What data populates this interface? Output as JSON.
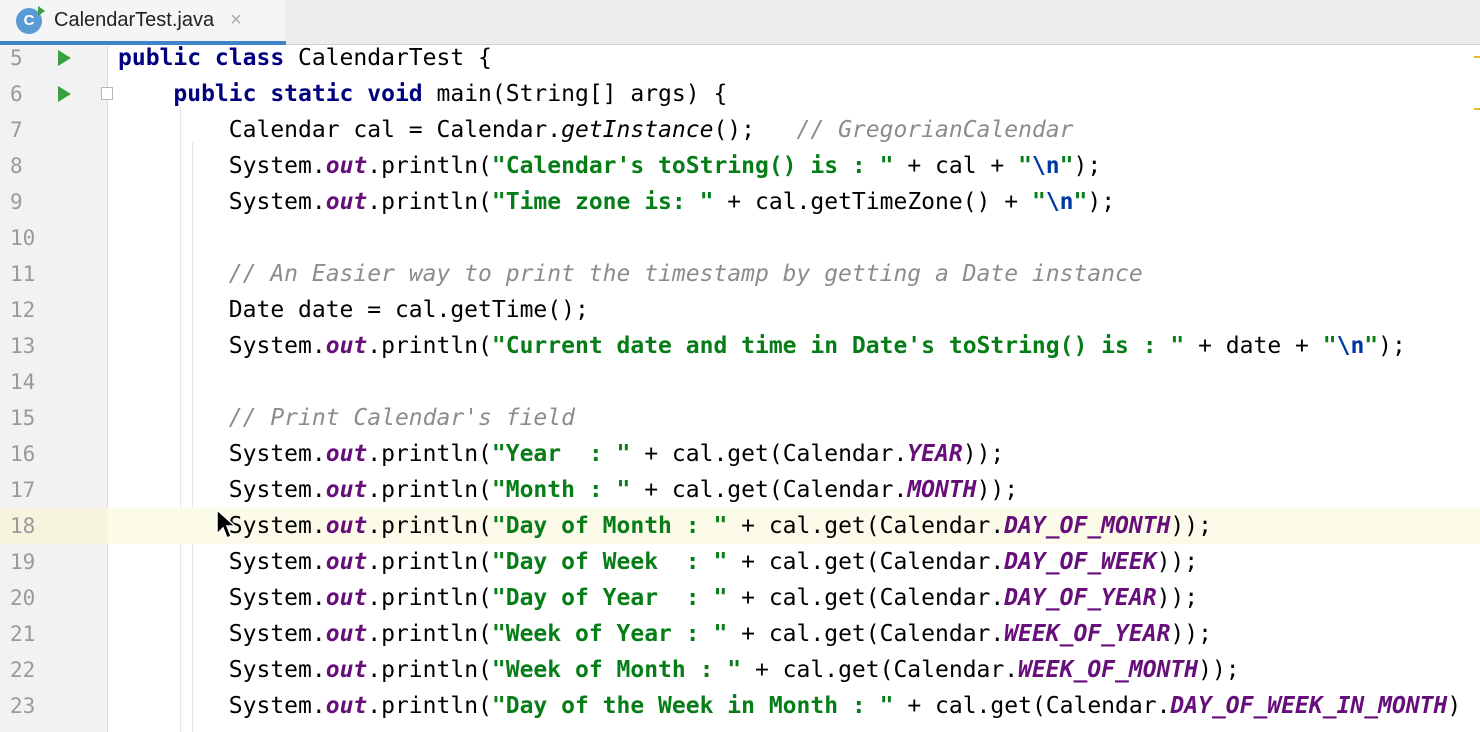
{
  "tab": {
    "filename": "CalendarTest.java",
    "icon": "java-class-icon",
    "close": "×"
  },
  "lines": [
    {
      "n": "5",
      "parts": [
        [
          "kw",
          "public class "
        ],
        [
          "",
          "CalendarTest {"
        ]
      ],
      "run": true
    },
    {
      "n": "6",
      "parts": [
        [
          "",
          "    "
        ],
        [
          "kw",
          "public static void "
        ],
        [
          "",
          "main(String[] args) {"
        ]
      ],
      "run": true,
      "fold": true
    },
    {
      "n": "7",
      "parts": [
        [
          "",
          "        Calendar cal = Calendar."
        ],
        [
          "method-it",
          "getInstance"
        ],
        [
          "",
          "();   "
        ],
        [
          "comment",
          "// GregorianCalendar"
        ]
      ]
    },
    {
      "n": "8",
      "parts": [
        [
          "",
          "        System."
        ],
        [
          "field",
          "out"
        ],
        [
          "",
          ".println("
        ],
        [
          "str",
          "\"Calendar's toString() is : \""
        ],
        [
          "",
          " + cal + "
        ],
        [
          "str",
          "\""
        ],
        [
          "esc",
          "\\n"
        ],
        [
          "str",
          "\""
        ],
        [
          "",
          ");"
        ]
      ]
    },
    {
      "n": "9",
      "parts": [
        [
          "",
          "        System."
        ],
        [
          "field",
          "out"
        ],
        [
          "",
          ".println("
        ],
        [
          "str",
          "\"Time zone is: \""
        ],
        [
          "",
          " + cal.getTimeZone() + "
        ],
        [
          "str",
          "\""
        ],
        [
          "esc",
          "\\n"
        ],
        [
          "str",
          "\""
        ],
        [
          "",
          ");"
        ]
      ]
    },
    {
      "n": "10",
      "parts": []
    },
    {
      "n": "11",
      "parts": [
        [
          "",
          "        "
        ],
        [
          "comment",
          "// An Easier way to print the timestamp by getting a Date instance"
        ]
      ]
    },
    {
      "n": "12",
      "parts": [
        [
          "",
          "        Date date = cal.getTime();"
        ]
      ]
    },
    {
      "n": "13",
      "parts": [
        [
          "",
          "        System."
        ],
        [
          "field",
          "out"
        ],
        [
          "",
          ".println("
        ],
        [
          "str",
          "\"Current date and time in Date's toString() is : \""
        ],
        [
          "",
          " + date + "
        ],
        [
          "str",
          "\""
        ],
        [
          "esc",
          "\\n"
        ],
        [
          "str",
          "\""
        ],
        [
          "",
          ");"
        ]
      ]
    },
    {
      "n": "14",
      "parts": []
    },
    {
      "n": "15",
      "parts": [
        [
          "",
          "        "
        ],
        [
          "comment",
          "// Print Calendar's field"
        ]
      ]
    },
    {
      "n": "16",
      "parts": [
        [
          "",
          "        System."
        ],
        [
          "field",
          "out"
        ],
        [
          "",
          ".println("
        ],
        [
          "str",
          "\"Year  : \""
        ],
        [
          "",
          " + cal.get(Calendar."
        ],
        [
          "field",
          "YEAR"
        ],
        [
          "",
          "));"
        ]
      ]
    },
    {
      "n": "17",
      "parts": [
        [
          "",
          "        System."
        ],
        [
          "field",
          "out"
        ],
        [
          "",
          ".println("
        ],
        [
          "str",
          "\"Month : \""
        ],
        [
          "",
          " + cal.get(Calendar."
        ],
        [
          "field",
          "MONTH"
        ],
        [
          "",
          "));"
        ]
      ]
    },
    {
      "n": "18",
      "parts": [
        [
          "",
          "        System."
        ],
        [
          "field",
          "out"
        ],
        [
          "",
          ".println("
        ],
        [
          "str",
          "\"Day of Month : \""
        ],
        [
          "",
          " + cal.get(Calendar."
        ],
        [
          "field",
          "DAY_OF_MONTH"
        ],
        [
          "",
          "));"
        ]
      ],
      "current": true
    },
    {
      "n": "19",
      "parts": [
        [
          "",
          "        System."
        ],
        [
          "field",
          "out"
        ],
        [
          "",
          ".println("
        ],
        [
          "str",
          "\"Day of Week  : \""
        ],
        [
          "",
          " + cal.get(Calendar."
        ],
        [
          "field",
          "DAY_OF_WEEK"
        ],
        [
          "",
          "));"
        ]
      ]
    },
    {
      "n": "20",
      "parts": [
        [
          "",
          "        System."
        ],
        [
          "field",
          "out"
        ],
        [
          "",
          ".println("
        ],
        [
          "str",
          "\"Day of Year  : \""
        ],
        [
          "",
          " + cal.get(Calendar."
        ],
        [
          "field",
          "DAY_OF_YEAR"
        ],
        [
          "",
          "));"
        ]
      ]
    },
    {
      "n": "21",
      "parts": [
        [
          "",
          "        System."
        ],
        [
          "field",
          "out"
        ],
        [
          "",
          ".println("
        ],
        [
          "str",
          "\"Week of Year : \""
        ],
        [
          "",
          " + cal.get(Calendar."
        ],
        [
          "field",
          "WEEK_OF_YEAR"
        ],
        [
          "",
          "));"
        ]
      ]
    },
    {
      "n": "22",
      "parts": [
        [
          "",
          "        System."
        ],
        [
          "field",
          "out"
        ],
        [
          "",
          ".println("
        ],
        [
          "str",
          "\"Week of Month : \""
        ],
        [
          "",
          " + cal.get(Calendar."
        ],
        [
          "field",
          "WEEK_OF_MONTH"
        ],
        [
          "",
          "));"
        ]
      ]
    },
    {
      "n": "23",
      "parts": [
        [
          "",
          "        System."
        ],
        [
          "field",
          "out"
        ],
        [
          "",
          ".println("
        ],
        [
          "str",
          "\"Day of the Week in Month : \""
        ],
        [
          "",
          " + cal.get(Calendar."
        ],
        [
          "field",
          "DAY_OF_WEEK_IN_MONTH"
        ],
        [
          ")",
          ")"
        ]
      ]
    }
  ]
}
